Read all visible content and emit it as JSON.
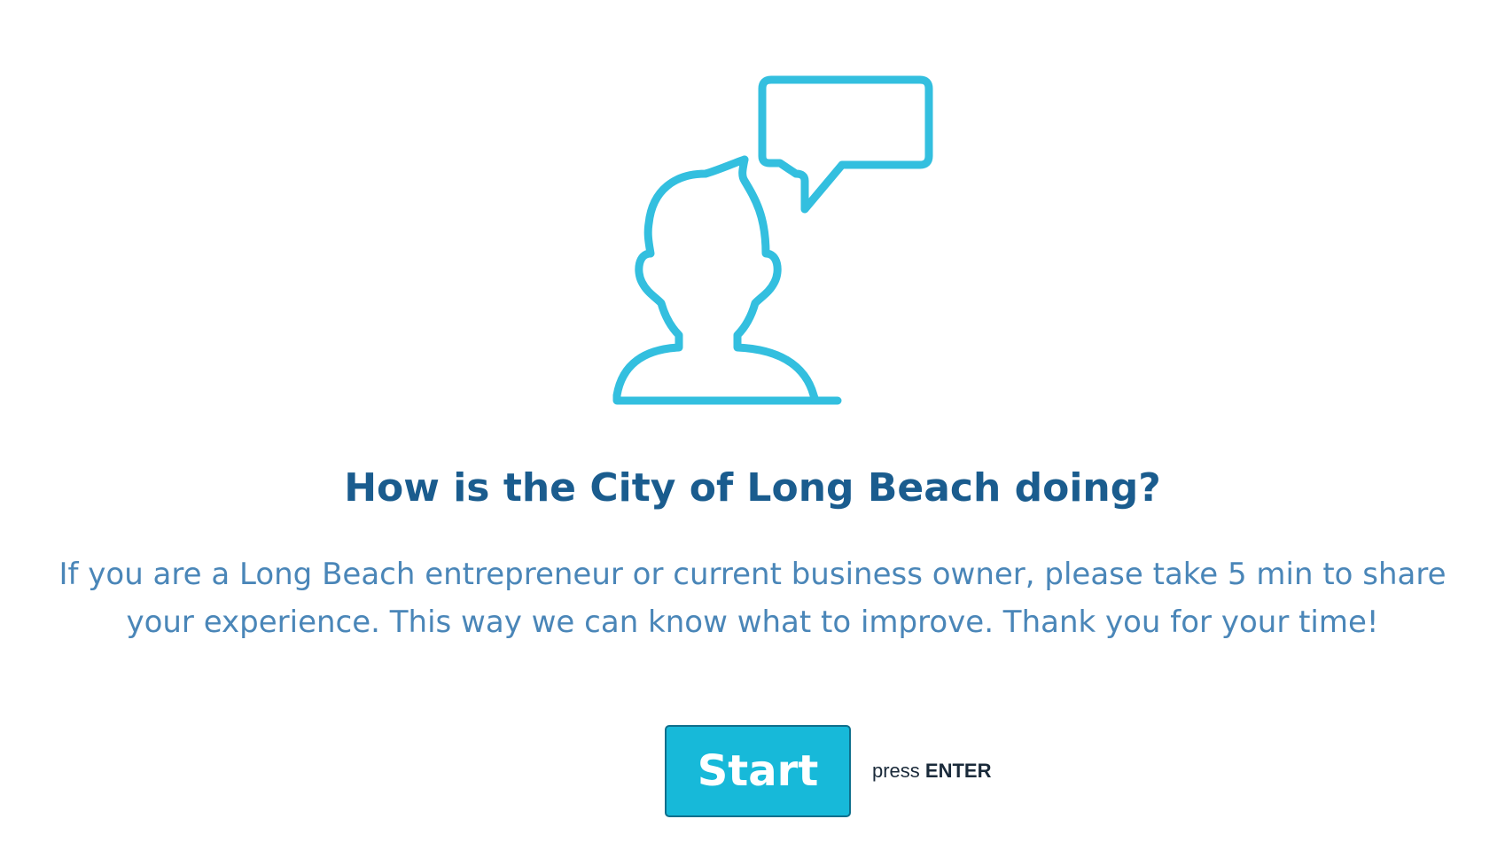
{
  "survey": {
    "title": "How is the City of Long Beach doing?",
    "description": "If you are a Long Beach entrepreneur or current business owner, please take 5 min to share your experience. This way we can know what to improve. Thank you for your time!",
    "start_label": "Start",
    "hint_prefix": "press",
    "hint_key": "ENTER"
  },
  "illustration": {
    "icon": "person-speech-bubble-icon",
    "color": "#33bfdf"
  },
  "colors": {
    "title": "#1a5c8e",
    "description": "#4a86b8",
    "button_bg": "#17b9d9",
    "button_border": "#0f6f8c"
  }
}
